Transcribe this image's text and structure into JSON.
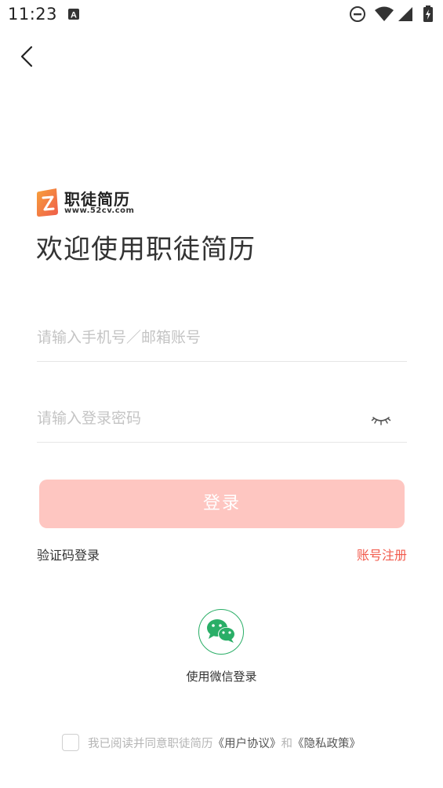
{
  "status_bar": {
    "time": "11:23",
    "icons": [
      "text-a-icon",
      "do-not-disturb-icon",
      "wifi-icon",
      "signal-icon",
      "battery-charging-icon"
    ]
  },
  "nav": {
    "back_icon": "chevron-left-icon"
  },
  "brand": {
    "name": "职徒简历",
    "url": "www.52cv.com",
    "logo_colors": [
      "#f7a13b",
      "#ef5b4a"
    ]
  },
  "welcome_title": "欢迎使用职徒简历",
  "form": {
    "account_placeholder": "请输入手机号／邮箱账号",
    "account_value": "",
    "password_placeholder": "请输入登录密码",
    "password_value": "",
    "password_toggle_icon": "eye-closed-icon",
    "login_label": "登录"
  },
  "links": {
    "sms_login": "验证码登录",
    "register": "账号注册"
  },
  "wechat": {
    "icon": "wechat-icon",
    "label": "使用微信登录"
  },
  "agreement": {
    "checked": false,
    "prefix": "我已阅读并同意职徒简历",
    "user_agreement": "《用户协议》",
    "conjunction": "和",
    "privacy_policy": "《隐私政策》"
  },
  "colors": {
    "login_button_bg": "#fec6c1",
    "register_link": "#f25b4d",
    "wechat_green": "#2aae67",
    "placeholder": "#c4c4c4"
  }
}
